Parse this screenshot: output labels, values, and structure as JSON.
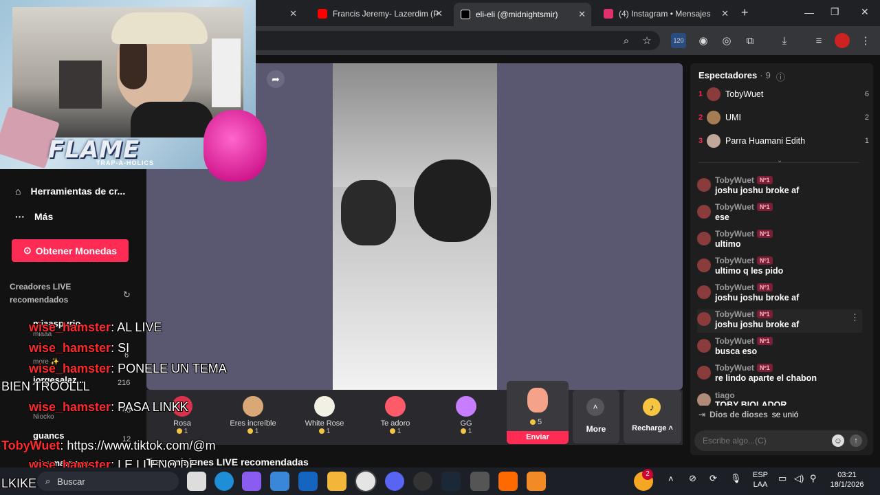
{
  "tabs": [
    {
      "title": "Francis Jeremy- Lazerdim (P",
      "favicon": "youtube-icon",
      "color": "#ff0000"
    },
    {
      "title": "eli-eli (@midnightsmir)",
      "favicon": "tiktok-icon",
      "color": "#ffffff"
    },
    {
      "title": "(4) Instagram • Mensajes",
      "favicon": "instagram-icon",
      "color": "#e1306c"
    }
  ],
  "toolbar": {
    "extension_badge": "120"
  },
  "leftnav": {
    "tools": "Herramientas de cr...",
    "more": "Más",
    "coins_button": "Obtener Monedas",
    "recommended_title": "Creadores LIVE recomendados",
    "creators": [
      {
        "name": "miaaspurio",
        "sub": "miaaa",
        "count": ""
      },
      {
        "name": "m...",
        "sub": "more ✨",
        "count": "6"
      },
      {
        "name": "jorgesalaz...",
        "sub": "",
        "count": "216"
      },
      {
        "name": "ni...",
        "sub": "Niocko",
        "count": "45"
      },
      {
        "name": "guancs",
        "sub": "",
        "count": "12"
      },
      {
        "name": "roxymarnaya",
        "sub": "",
        "count": ""
      }
    ],
    "recommended_streams": "Transmisiones LIVE recomendadas"
  },
  "gifts": [
    {
      "name": "Rosa",
      "price": "1"
    },
    {
      "name": "Eres increíble",
      "price": "1"
    },
    {
      "name": "White Rose",
      "price": "1"
    },
    {
      "name": "Te adoro",
      "price": "1"
    },
    {
      "name": "GG",
      "price": "1"
    }
  ],
  "selected_gift": {
    "price": "5",
    "send_label": "Enviar"
  },
  "more_label": "More",
  "recharge_label": "Recharge",
  "viewers": {
    "title": "Espectadores",
    "count": "9",
    "list": [
      {
        "rank": "1",
        "name": "TobyWuet",
        "score": "6"
      },
      {
        "rank": "2",
        "name": "UMI",
        "score": "2"
      },
      {
        "rank": "3",
        "name": "Parra Huamani Edith",
        "score": "1"
      }
    ]
  },
  "chat": [
    {
      "user": "TobyWuet",
      "badge": "Nº1",
      "text": "joshu joshu broke af"
    },
    {
      "user": "TobyWuet",
      "badge": "Nº1",
      "text": "ese"
    },
    {
      "user": "TobyWuet",
      "badge": "Nº1",
      "text": "ultimo"
    },
    {
      "user": "TobyWuet",
      "badge": "Nº1",
      "text": "ultimo q les pido"
    },
    {
      "user": "TobyWuet",
      "badge": "Nº1",
      "text": "joshu joshu broke af"
    },
    {
      "user": "TobyWuet",
      "badge": "Nº1",
      "text": "joshu joshu broke af"
    },
    {
      "user": "TobyWuet",
      "badge": "Nº1",
      "text": "busca eso"
    },
    {
      "user": "TobyWuet",
      "badge": "Nº1",
      "text": "re lindo aparte el chabon"
    },
    {
      "user": "tiago",
      "badge": "",
      "text": "TOBY BIOLADOR"
    }
  ],
  "join_notice": {
    "user": "Dios de dioses",
    "text": "se unió"
  },
  "chat_input": {
    "placeholder": "Escribe algo...(C)"
  },
  "overlay": {
    "logo": "FLAME",
    "logo_sub": "TRAP-A-HOLICS",
    "messages": [
      {
        "user": "wise_hamster",
        "text": ": AL LIVE"
      },
      {
        "user": "wise_hamster",
        "text": ": SI"
      },
      {
        "user": "wise_hamster",
        "text": ": PONELE UN TEMA"
      },
      {
        "user": "BIEN TROOLLL",
        "text": ""
      },
      {
        "user": "wise_hamster",
        "text": ": PASA LINKK"
      },
      {
        "user": "TobyWuet",
        "text": ": https://www.tiktok.com/@m"
      },
      {
        "user": "wise_hamster",
        "text": ": LE LLENO DE"
      },
      {
        "user": "LKIKE",
        "text": ""
      }
    ]
  },
  "taskbar": {
    "search_placeholder": "Buscar",
    "language": "ESP",
    "layout": "LAA",
    "time": "03:21",
    "date": "18/1/2026",
    "notification_count": "2"
  }
}
